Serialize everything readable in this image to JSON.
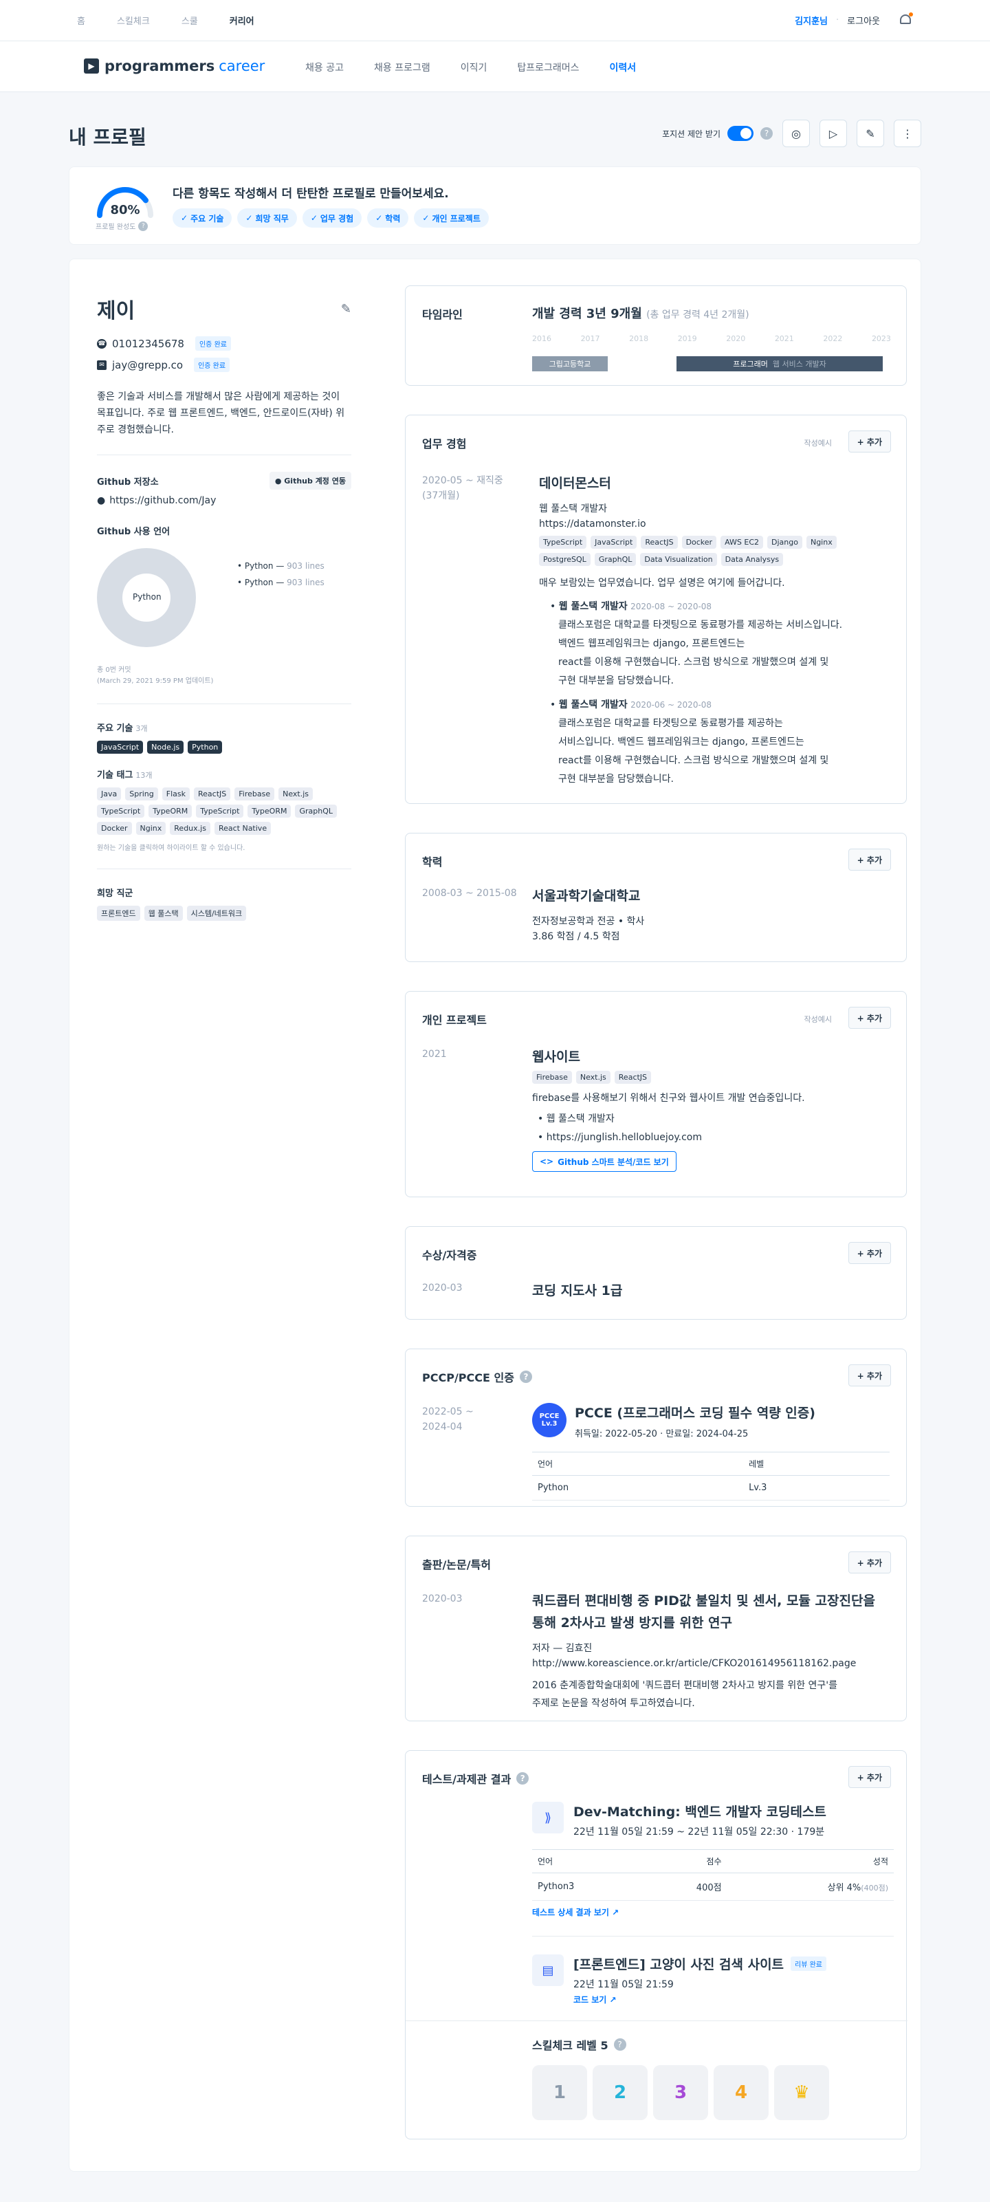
{
  "top_nav": [
    "홈",
    "스킬체크",
    "스쿨",
    "커리어"
  ],
  "top_right": {
    "user": "김지훈님",
    "logout": "로그아웃"
  },
  "brand": {
    "name": "programmers",
    "suffix": "career"
  },
  "main_nav": [
    "채용 공고",
    "채용 프로그램",
    "이직기",
    "탑프로그래머스",
    "이력서"
  ],
  "page": {
    "title": "내 프로필",
    "position_toggle": "포지션 제안 받기"
  },
  "completion": {
    "percent": "80%",
    "value": 0.8,
    "label": "프로필 완성도",
    "title": "다른 항목도 작성해서 더 탄탄한 프로필로 만들어보세요.",
    "chips": [
      "주요 기술",
      "희망 직무",
      "업무 경험",
      "학력",
      "개인 프로젝트"
    ]
  },
  "profile": {
    "name": "제이",
    "phone": "01012345678",
    "email": "jay@grepp.co",
    "verified": "인증 완료",
    "intro": "좋은 기술과 서비스를 개발해서 많은 사람에게 제공하는 것이 목표입니다. 주로 웹 프론트엔드, 백엔드, 안드로이드(자바) 위주로 경험했습니다.",
    "github_label": "Github 저장소",
    "github_btn": "Github 계정 연동",
    "github_url": "https://github.com/Jay",
    "lang_label": "Github 사용 언어",
    "pie_label": "Python",
    "legend": [
      {
        "name": "Python —",
        "lines": "903 lines"
      },
      {
        "name": "Python —",
        "lines": "903 lines"
      }
    ],
    "commits": "총 0번 커밋",
    "updated": "(March 29, 2021 9:59 PM 업데이트)",
    "main_skill_label": "주요 기술",
    "main_skill_count": "3개",
    "main_skills": [
      "JavaScript",
      "Node.js",
      "Python"
    ],
    "tag_label": "기술 태그",
    "tag_count": "13개",
    "tags": [
      "Java",
      "Spring",
      "Flask",
      "ReactJS",
      "Firebase",
      "Next.js",
      "TypeScript",
      "TypeORM",
      "TypeScript",
      "TypeORM",
      "GraphQL",
      "Docker",
      "Nginx",
      "Redux.js",
      "React Native"
    ],
    "tag_hint": "원하는 기술을 클릭하여 하이라이트 할 수 있습니다.",
    "job_label": "희망 직군",
    "jobs": [
      "프론트엔드",
      "웹 풀스택",
      "시스템/네트워크"
    ]
  },
  "timeline": {
    "title": "타임라인",
    "summary": "개발 경력 3년 9개월",
    "total": "(총 업무 경력 4년 2개월)",
    "years": [
      "2016",
      "2017",
      "2018",
      "2019",
      "2020",
      "2021",
      "2022",
      "2023"
    ],
    "bar1": "그립고등학교",
    "bar2": "프로그래머",
    "bar2b": "웹 서비스 개발자"
  },
  "work": {
    "title": "업무 경험",
    "sample": "작성예시",
    "add": "+ 추가",
    "period": "2020-05 ~ 재직중",
    "months": "(37개월)",
    "company": "데이터몬스터",
    "role": "웹 풀스택 개발자",
    "url": "https://datamonster.io",
    "tags": [
      "TypeScript",
      "JavaScript",
      "ReactJS",
      "Docker",
      "AWS EC2",
      "Django",
      "Nginx",
      "PostgreSQL",
      "GraphQL",
      "Data Visualization",
      "Data Analysys"
    ],
    "desc": "매우 보람있는 업무였습니다. 업무 설명은 여기에 들어갑니다.",
    "items": [
      {
        "title": "웹 풀스택 개발자",
        "period": "2020-08 ~ 2020-08",
        "lines": [
          "클래스포럼은 대학교를 타겟팅으로 동료평가를 제공하는 서비스입니다.",
          "백엔드 웹프레임워크는 django, 프론트엔드는",
          "react를 이용해 구현했습니다. 스크럼 방식으로 개발했으며 설계 및",
          "구현 대부분을 담당했습니다."
        ]
      },
      {
        "title": "웹 풀스택 개발자",
        "period": "2020-06 ~ 2020-08",
        "lines": [
          "클래스포럼은 대학교를 타겟팅으로 동료평가를 제공하는",
          "서비스입니다. 백엔드 웹프레임워크는 django, 프론트엔드는",
          "react를 이용해 구현했습니다. 스크럼 방식으로 개발했으며 설계 및",
          "구현 대부분을 담당했습니다."
        ]
      }
    ]
  },
  "edu": {
    "title": "학력",
    "add": "+ 추가",
    "period": "2008-03 ~ 2015-08",
    "school": "서울과학기술대학교",
    "major": "전자정보공학과 전공 • 학사",
    "gpa": "3.86 학점 / 4.5 학점"
  },
  "project": {
    "title": "개인 프로젝트",
    "sample": "작성예시",
    "add": "+ 추가",
    "period": "2021",
    "name": "웹사이트",
    "tags": [
      "Firebase",
      "Next.js",
      "ReactJS"
    ],
    "desc": "firebase를 사용해보기 위해서 친구와 웹사이트 개발 연습중입니다.",
    "bullets": [
      "웹 풀스택 개발자",
      "https://junglish.hellobluejoy.com"
    ],
    "btn": "Github 스마트 분석/코드 보기"
  },
  "award": {
    "title": "수상/자격증",
    "add": "+ 추가",
    "period": "2020-03",
    "name": "코딩 지도사 1급"
  },
  "pccp": {
    "title": "PCCP/PCCE 인증",
    "add": "+ 추가",
    "period": "2022-05 ~",
    "period2": "2024-04",
    "badge": "PCCE",
    "badge_lv": "Lv.3",
    "name": "PCCE (프로그래머스 코딩 필수 역량 인증)",
    "dates": "취득일: 2022-05-20 · 만료일: 2024-04-25",
    "col1": "언어",
    "col2": "레벨",
    "lang": "Python",
    "level": "Lv.3"
  },
  "paper": {
    "title": "출판/논문/특허",
    "add": "+ 추가",
    "period": "2020-03",
    "name1": "쿼드콥터 편대비행 중 PID값 불일치 및 센서, 모듈 고장진단을",
    "name2": "통해 2차사고 발생 방지를 위한 연구",
    "author": "저자 — 김효진",
    "url": "http://www.koreascience.or.kr/article/CFKO201614956118162.page",
    "desc1": "2016 춘계종합학술대회에 '쿼드콥터 편대비행 2차사고 방지를 위한 연구'를",
    "desc2": "주제로 논문을 작성하여 투고하였습니다."
  },
  "tests": {
    "title": "테스트/과제관 결과",
    "add": "+ 추가",
    "t1": {
      "name": "Dev-Matching: 백엔드 개발자 코딩테스트",
      "date": "22년 11월 05일 21:59 ~ 22년 11월 05일 22:30 · 179분",
      "cols": [
        "언어",
        "점수",
        "성적"
      ],
      "lang": "Python3",
      "score": "400점",
      "rank": "상위 4%",
      "rank2": "(400점)",
      "link": "테스트 상세 결과 보기"
    },
    "t2": {
      "name": "[프론트엔드] 고양이 사진 검색 사이트",
      "badge": "리뷰 완료",
      "date": "22년 11월 05일 21:59",
      "link": "코드 보기"
    },
    "skill": "스킬체크 레벨 5",
    "levels": [
      "1",
      "2",
      "3",
      "4",
      "5"
    ]
  }
}
